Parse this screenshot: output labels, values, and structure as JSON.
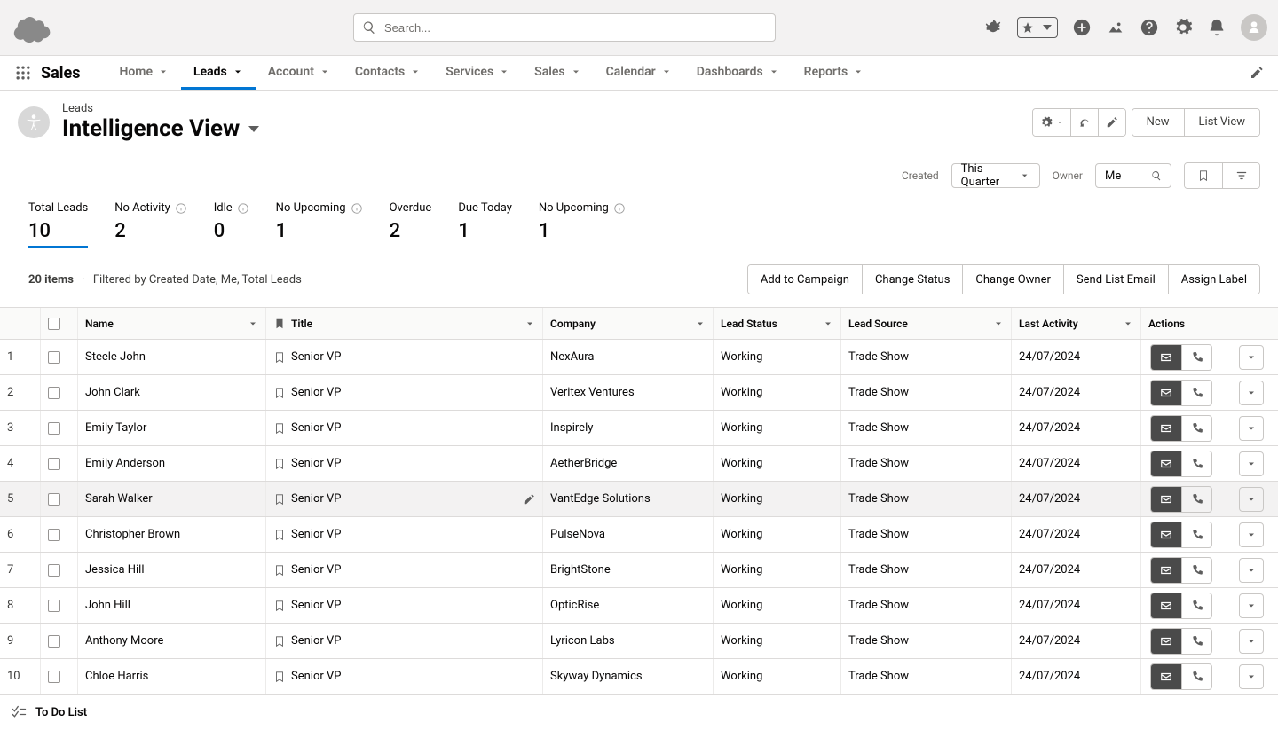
{
  "search": {
    "placeholder": "Search..."
  },
  "app": {
    "name": "Sales"
  },
  "nav_tabs": [
    {
      "label": "Home"
    },
    {
      "label": "Leads",
      "active": true
    },
    {
      "label": "Account"
    },
    {
      "label": "Contacts"
    },
    {
      "label": "Services"
    },
    {
      "label": "Sales"
    },
    {
      "label": "Calendar"
    },
    {
      "label": "Dashboards"
    },
    {
      "label": "Reports"
    }
  ],
  "page": {
    "object_label": "Leads",
    "view_title": "Intelligence View",
    "actions": {
      "new": "New",
      "list_view": "List View"
    }
  },
  "filters": {
    "created_label": "Created",
    "created_value": "This Quarter",
    "owner_label": "Owner",
    "owner_value": "Me"
  },
  "stats": [
    {
      "label": "Total Leads",
      "value": "10",
      "info": false,
      "active": true
    },
    {
      "label": "No Activity",
      "value": "2",
      "info": true
    },
    {
      "label": "Idle",
      "value": "0",
      "info": true
    },
    {
      "label": "No Upcoming",
      "value": "1",
      "info": true
    },
    {
      "label": "Overdue",
      "value": "2",
      "info": false
    },
    {
      "label": "Due Today",
      "value": "1",
      "info": false
    },
    {
      "label": "No Upcoming",
      "value": "1",
      "info": true
    }
  ],
  "meta": {
    "count": "20 items",
    "filter_desc": "Filtered by Created Date, Me, Total Leads"
  },
  "list_actions": [
    "Add to Campaign",
    "Change Status",
    "Change Owner",
    "Send List Email",
    "Assign Label"
  ],
  "columns": {
    "name": "Name",
    "title": "Title",
    "company": "Company",
    "lead_status": "Lead Status",
    "lead_source": "Lead Source",
    "last_activity": "Last Activity",
    "actions": "Actions"
  },
  "rows": [
    {
      "n": "1",
      "name": "Steele John",
      "title": "Senior VP",
      "company": "NexAura",
      "status": "Working",
      "source": "Trade Show",
      "last": "24/07/2024"
    },
    {
      "n": "2",
      "name": "John Clark",
      "title": "Senior VP",
      "company": "Veritex Ventures",
      "status": "Working",
      "source": "Trade Show",
      "last": "24/07/2024"
    },
    {
      "n": "3",
      "name": "Emily Taylor",
      "title": "Senior VP",
      "company": "Inspirely",
      "status": "Working",
      "source": "Trade Show",
      "last": "24/07/2024"
    },
    {
      "n": "4",
      "name": "Emily Anderson",
      "title": "Senior VP",
      "company": "AetherBridge",
      "status": "Working",
      "source": "Trade Show",
      "last": "24/07/2024"
    },
    {
      "n": "5",
      "name": "Sarah Walker",
      "title": "Senior VP",
      "company": "VantEdge Solutions",
      "status": "Working",
      "source": "Trade Show",
      "last": "24/07/2024"
    },
    {
      "n": "6",
      "name": "Christopher Brown",
      "title": "Senior VP",
      "company": "PulseNova",
      "status": "Working",
      "source": "Trade Show",
      "last": "24/07/2024"
    },
    {
      "n": "7",
      "name": "Jessica Hill",
      "title": "Senior VP",
      "company": "BrightStone",
      "status": "Working",
      "source": "Trade Show",
      "last": "24/07/2024"
    },
    {
      "n": "8",
      "name": "John Hill",
      "title": "Senior VP",
      "company": "OpticRise",
      "status": "Working",
      "source": "Trade Show",
      "last": "24/07/2024"
    },
    {
      "n": "9",
      "name": "Anthony Moore",
      "title": "Senior VP",
      "company": "Lyricon Labs",
      "status": "Working",
      "source": "Trade Show",
      "last": "24/07/2024"
    },
    {
      "n": "10",
      "name": "Chloe Harris",
      "title": "Senior VP",
      "company": "Skyway Dynamics",
      "status": "Working",
      "source": "Trade Show",
      "last": "24/07/2024"
    }
  ],
  "footer": {
    "todo": "To Do List"
  }
}
